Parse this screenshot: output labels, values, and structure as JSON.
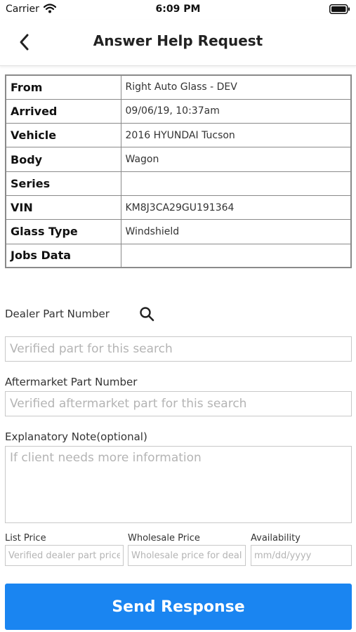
{
  "status_bar": {
    "carrier": "Carrier",
    "time": "6:09 PM"
  },
  "header": {
    "title": "Answer Help Request",
    "back_icon": "chevron-left-icon"
  },
  "info_table": {
    "rows": [
      {
        "key": "From",
        "value": "Right Auto Glass - DEV"
      },
      {
        "key": "Arrived",
        "value": "09/06/19, 10:37am"
      },
      {
        "key": "Vehicle",
        "value": "2016 HYUNDAI Tucson"
      },
      {
        "key": "Body",
        "value": "Wagon"
      },
      {
        "key": "Series",
        "value": ""
      },
      {
        "key": "VIN",
        "value": "KM8J3CA29GU191364"
      },
      {
        "key": "Glass Type",
        "value": "Windshield"
      },
      {
        "key": "Jobs Data",
        "value": ""
      }
    ]
  },
  "form": {
    "dealer_part": {
      "label": "Dealer Part Number",
      "placeholder": "Verified part for this search",
      "value": "",
      "icon": "search-icon"
    },
    "aftermarket_part": {
      "label": "Aftermarket Part Number",
      "placeholder": "Verified aftermarket part for this search",
      "value": ""
    },
    "note": {
      "label": "Explanatory Note(optional)",
      "placeholder": "If client needs more information",
      "value": ""
    },
    "list_price": {
      "label": "List Price",
      "placeholder": "Verified dealer part price",
      "value": ""
    },
    "wholesale_price": {
      "label": "Wholesale Price",
      "placeholder": "Wholesale price for dealer part",
      "value": ""
    },
    "availability": {
      "label": "Availability",
      "placeholder": "mm/dd/yyyy",
      "value": ""
    },
    "submit_label": "Send Response",
    "accent_color": "#1a85f1"
  }
}
